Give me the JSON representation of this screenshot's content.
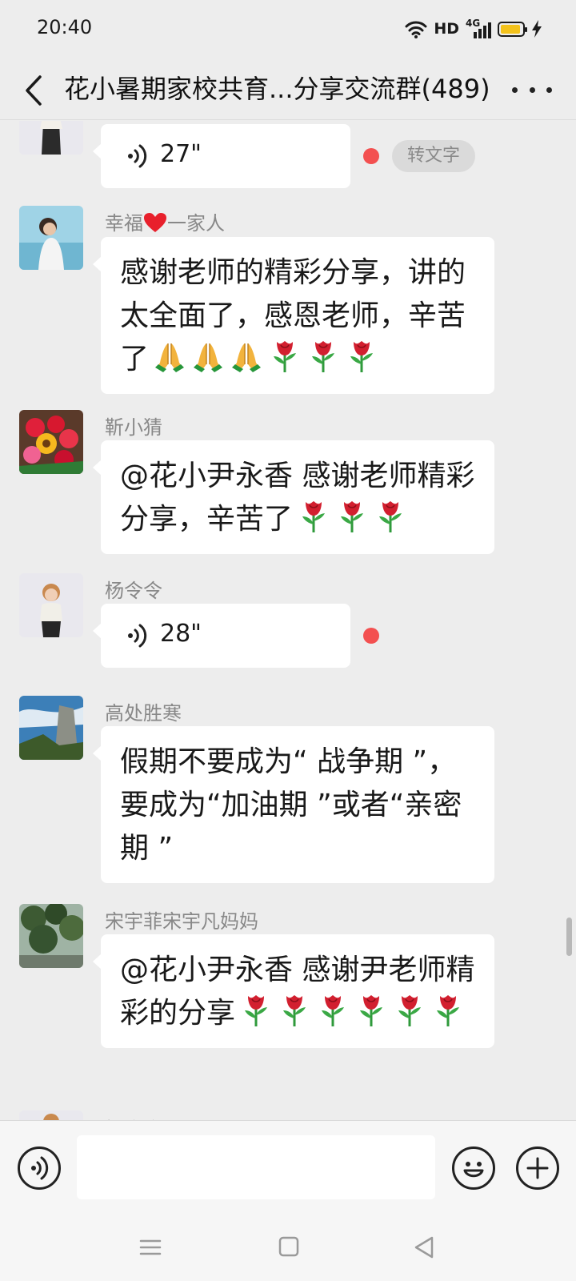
{
  "status_bar": {
    "time": "20:40",
    "hd": "HD",
    "network": "4G"
  },
  "header": {
    "title": "花小暑期家校共育...分享交流群(489)"
  },
  "messages": [
    {
      "kind": "voice",
      "duration": "27\"",
      "unread": true,
      "to_text_label": "转文字"
    },
    {
      "sender": "幸福",
      "sender_suffix": "一家人",
      "text": "感谢老师的精彩分享，讲的太全面了，感恩老师，辛苦了",
      "emojis": [
        "folded-hands",
        "folded-hands",
        "folded-hands",
        "rose",
        "rose",
        "rose"
      ]
    },
    {
      "sender": "靳小猜",
      "text": "@花小尹永香  感谢老师精彩分享，辛苦了",
      "emojis": [
        "rose",
        "rose",
        "rose"
      ]
    },
    {
      "sender": "杨令令",
      "kind": "voice",
      "duration": "28\"",
      "unread": true
    },
    {
      "sender": "高处胜寒",
      "text": "假期不要成为“ 战争期 ”，要成为“加油期 ”或者“亲密期 ”"
    },
    {
      "sender": "宋宇菲宋宇凡妈妈",
      "text": "@花小尹永香  感谢尹老师精彩的分享",
      "emojis": [
        "rose",
        "rose",
        "rose",
        "rose",
        "rose",
        "rose"
      ]
    },
    {
      "sender": "杨令令"
    }
  ],
  "input_bar": {
    "value": ""
  },
  "colors": {
    "background": "#ededed",
    "bubble": "#ffffff",
    "unread_dot": "#f35050",
    "sender_text": "#888888"
  }
}
